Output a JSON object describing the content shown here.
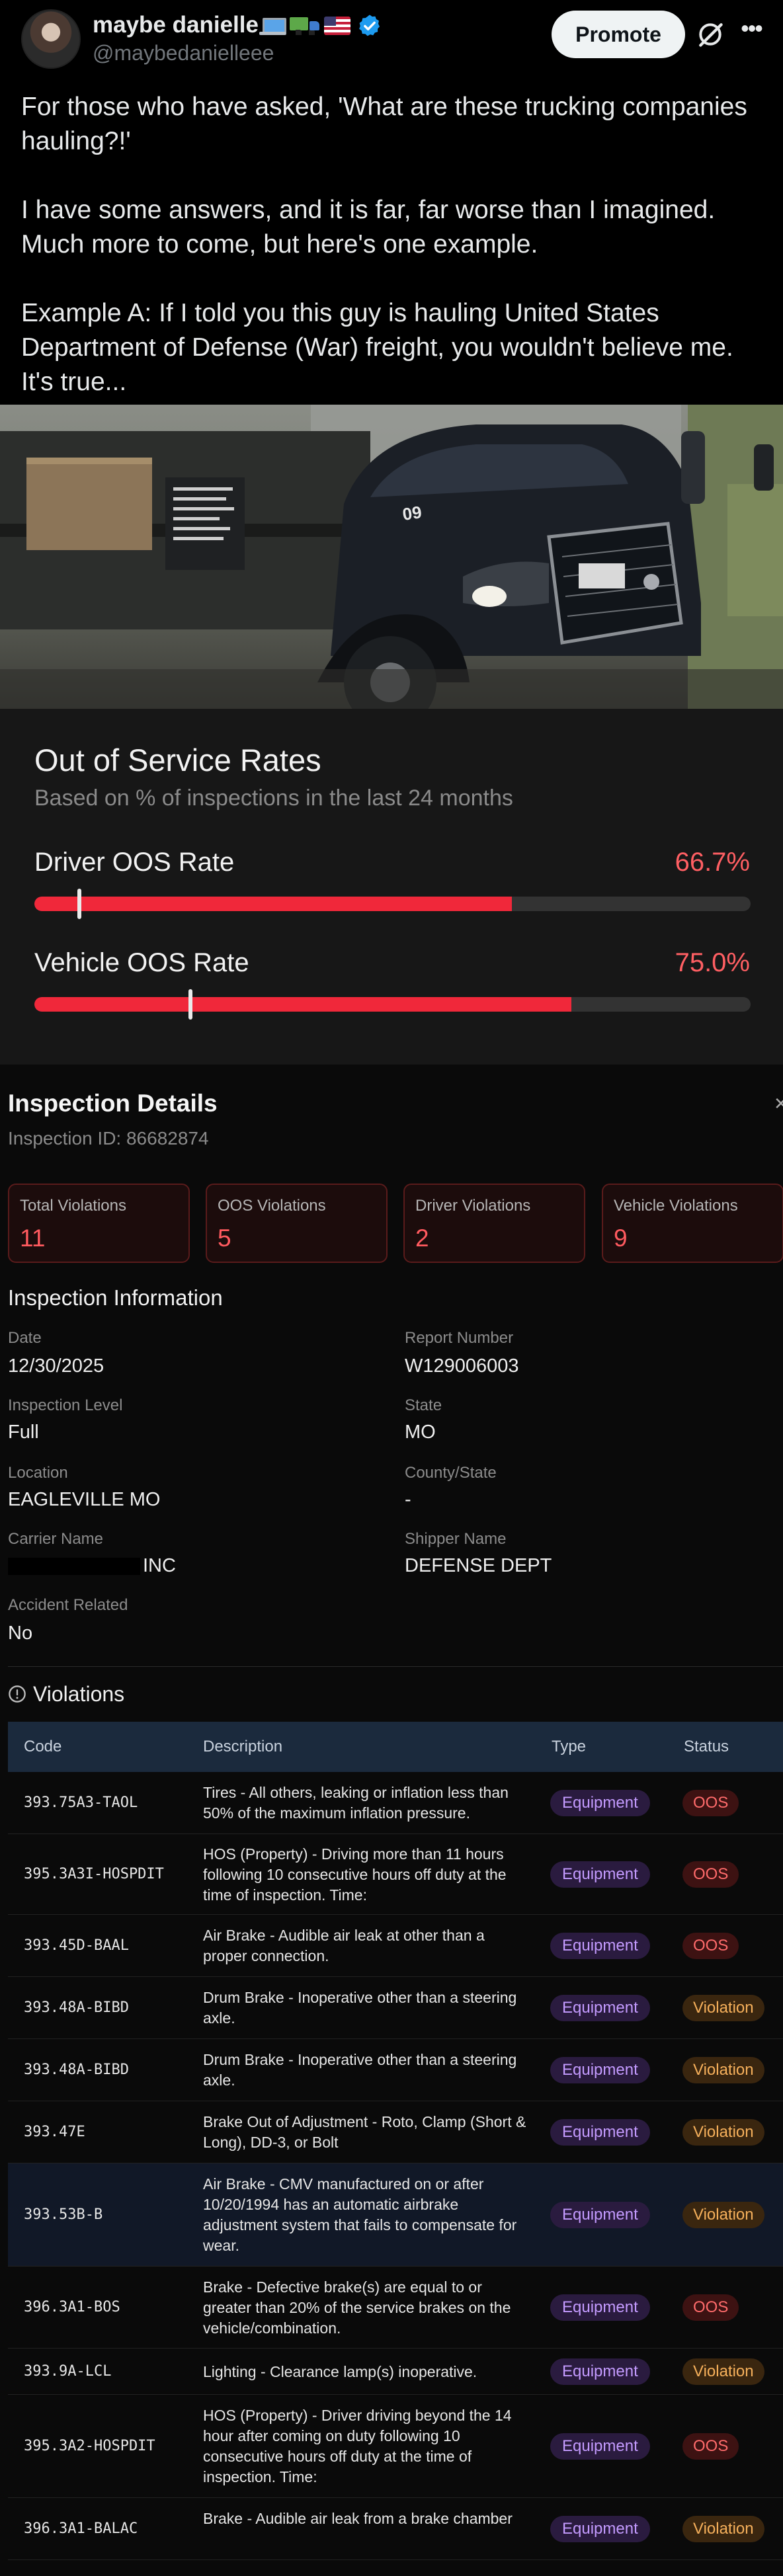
{
  "tweet": {
    "display_name": "maybe danielle",
    "emojis": [
      "laptop-emoji",
      "truck-emoji",
      "us-flag-emoji"
    ],
    "handle": "@maybedanielleee",
    "promote_label": "Promote",
    "paragraphs": [
      "For those who have asked, 'What are these trucking companies hauling?!'",
      "I have some answers, and it is far, far worse than I imagined. Much more to come, but here's one example.",
      "Example A: If I told you this guy is hauling United States Department of Defense (War) freight, you wouldn't believe me. It's true..."
    ]
  },
  "oos": {
    "title": "Out of Service Rates",
    "subtitle": "Based on % of inspections in the last 24 months",
    "rates": [
      {
        "label": "Driver OOS Rate",
        "value": "66.7%",
        "fill": 0.667,
        "marker": 0.06
      },
      {
        "label": "Vehicle OOS Rate",
        "value": "75.0%",
        "fill": 0.75,
        "marker": 0.215
      }
    ]
  },
  "inspection": {
    "title": "Inspection Details",
    "id_text": "Inspection ID: 86682874",
    "stats": [
      {
        "label": "Total Violations",
        "value": "11"
      },
      {
        "label": "OOS Violations",
        "value": "5"
      },
      {
        "label": "Driver Violations",
        "value": "2"
      },
      {
        "label": "Vehicle Violations",
        "value": "9"
      }
    ],
    "info_title": "Inspection Information",
    "info": [
      {
        "label": "Date",
        "value": "12/30/2025"
      },
      {
        "label": "Report Number",
        "value": "W129006003"
      },
      {
        "label": "Inspection Level",
        "value": "Full"
      },
      {
        "label": "State",
        "value": "MO"
      },
      {
        "label": "Location",
        "value": "EAGLEVILLE MO"
      },
      {
        "label": "County/State",
        "value": "-"
      },
      {
        "label": "Carrier Name",
        "value": "INC"
      },
      {
        "label": "Shipper Name",
        "value": "DEFENSE DEPT"
      },
      {
        "label": "Accident Related",
        "value": "No"
      }
    ],
    "violations_title": "Violations"
  },
  "violations": {
    "headers": {
      "code": "Code",
      "description": "Description",
      "type": "Type",
      "status": "Status"
    },
    "rows": [
      {
        "code": "393.75A3-TAOL",
        "description": "Tires - All others, leaking or inflation less than 50% of the maximum inflation pressure.",
        "type": "Equipment",
        "status": "OOS"
      },
      {
        "code": "395.3A3I-HOSPDIT",
        "description": "HOS (Property) - Driving more than 11 hours following 10 consecutive hours off duty at the time of inspection. Time:",
        "type": "Equipment",
        "status": "OOS"
      },
      {
        "code": "393.45D-BAAL",
        "description": "Air Brake - Audible air leak at other than a proper connection.",
        "type": "Equipment",
        "status": "OOS"
      },
      {
        "code": "393.48A-BIBD",
        "description": "Drum Brake - Inoperative other than a steering axle.",
        "type": "Equipment",
        "status": "Violation"
      },
      {
        "code": "393.48A-BIBD",
        "description": "Drum Brake - Inoperative other than a steering axle.",
        "type": "Equipment",
        "status": "Violation"
      },
      {
        "code": "393.47E",
        "description": "Brake Out of Adjustment - Roto, Clamp (Short & Long), DD-3, or Bolt",
        "type": "Equipment",
        "status": "Violation"
      },
      {
        "code": "393.53B-B",
        "description": "Air Brake - CMV manufactured on or after 10/20/1994 has an automatic airbrake adjustment system that fails to compensate for wear.",
        "type": "Equipment",
        "status": "Violation"
      },
      {
        "code": "396.3A1-BOS",
        "description": "Brake - Defective brake(s) are equal to or greater than 20% of the service brakes on the vehicle/combination.",
        "type": "Equipment",
        "status": "OOS"
      },
      {
        "code": "393.9A-LCL",
        "description": "Lighting - Clearance lamp(s) inoperative.",
        "type": "Equipment",
        "status": "Violation"
      },
      {
        "code": "395.3A2-HOSPDIT",
        "description": "HOS (Property) - Driver driving beyond the 14 hour after coming on duty following 10 consecutive hours off duty at the time of inspection. Time:",
        "type": "Equipment",
        "status": "OOS"
      },
      {
        "code": "396.3A1-BALAC",
        "description": "Brake - Audible air leak from a brake chamber",
        "type": "Equipment",
        "status": "Violation"
      }
    ]
  },
  "colors": {
    "oos_red": "#f0283a",
    "violation_amber": "#f6b05b",
    "equipment_purple": "#c49bff"
  }
}
